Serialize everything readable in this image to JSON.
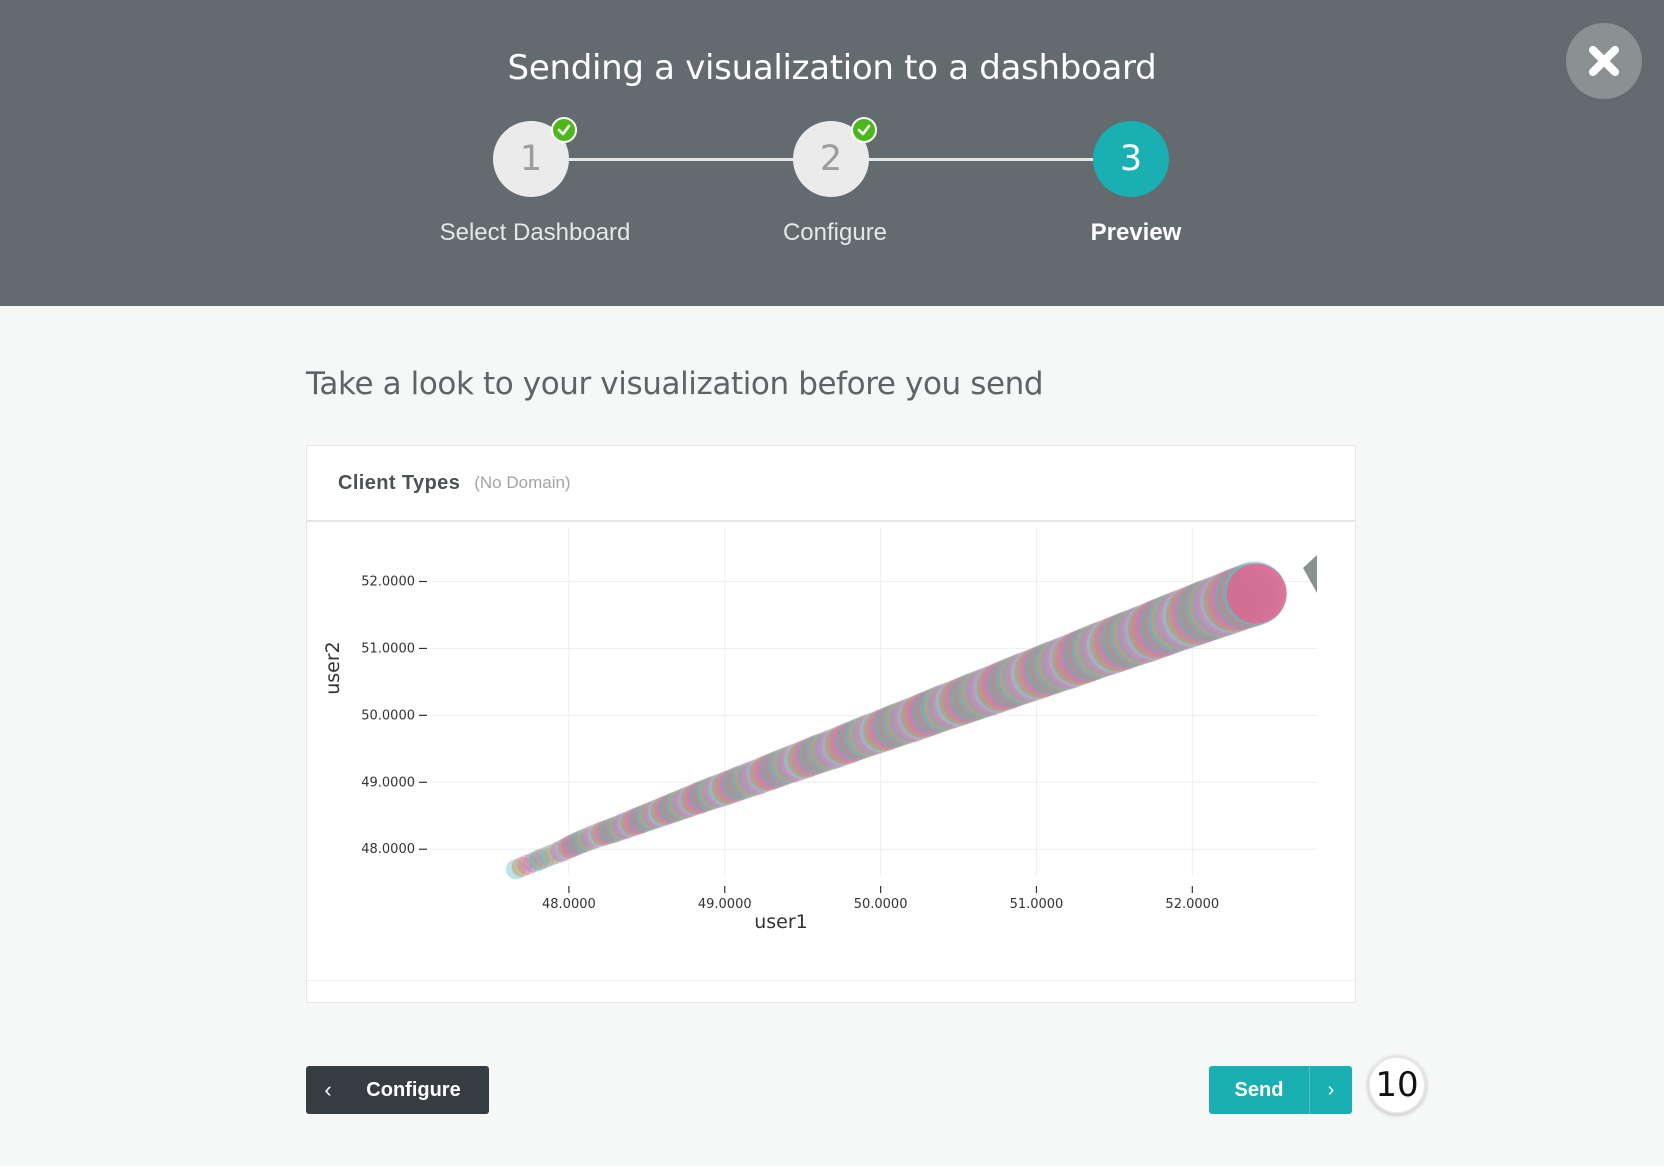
{
  "header": {
    "title": "Sending a visualization to a dashboard",
    "steps": [
      {
        "number": "1",
        "label": "Select Dashboard",
        "completed": true
      },
      {
        "number": "2",
        "label": "Configure",
        "completed": true
      },
      {
        "number": "3",
        "label": "Preview",
        "active": true
      }
    ],
    "close_icon": "close-icon"
  },
  "main": {
    "heading": "Take a look to your visualization before you send"
  },
  "card": {
    "title": "Client Types",
    "subtitle": "(No Domain)"
  },
  "chart_data": {
    "type": "scatter",
    "xlabel": "user1",
    "ylabel": "user2",
    "xlim": [
      47.25,
      52.8
    ],
    "ylim": [
      47.6,
      52.65
    ],
    "x_ticks": [
      "48.0000",
      "49.0000",
      "50.0000",
      "51.0000",
      "52.0000"
    ],
    "x_tick_values": [
      48,
      49,
      50,
      51,
      52
    ],
    "y_ticks": [
      "48.0000",
      "49.0000",
      "50.0000",
      "51.0000",
      "52.0000"
    ],
    "y_tick_values": [
      48,
      49,
      50,
      51,
      52
    ],
    "series": [
      {
        "x": [
          47.66,
          47.81,
          47.95,
          48.02,
          48.1,
          48.2,
          48.28,
          48.36,
          48.44,
          48.52,
          48.6,
          48.68,
          48.76,
          48.84,
          48.92,
          49.0,
          49.1,
          49.2,
          49.3,
          49.4,
          49.5,
          49.6,
          49.7,
          49.8,
          49.9,
          50.0,
          50.1,
          50.2,
          50.3,
          50.4,
          50.5,
          50.6,
          50.7,
          50.8,
          50.9,
          51.0,
          51.1,
          51.2,
          51.3,
          51.4,
          51.5,
          51.6,
          51.7,
          51.8,
          51.9,
          52.0,
          52.1,
          52.2,
          52.3,
          52.4
        ],
        "y": [
          47.7,
          47.84,
          47.97,
          48.05,
          48.13,
          48.22,
          48.28,
          48.35,
          48.42,
          48.49,
          48.56,
          48.63,
          48.7,
          48.77,
          48.84,
          48.9,
          48.99,
          49.07,
          49.16,
          49.25,
          49.33,
          49.42,
          49.5,
          49.59,
          49.68,
          49.76,
          49.85,
          49.93,
          50.02,
          50.11,
          50.19,
          50.28,
          50.36,
          50.45,
          50.54,
          50.62,
          50.71,
          50.79,
          50.88,
          50.97,
          51.05,
          51.14,
          51.22,
          51.31,
          51.4,
          51.48,
          51.57,
          51.65,
          51.74,
          51.82
        ]
      }
    ],
    "point_colors": [
      "#7fcfd8",
      "#c98a4a",
      "#d97a9e",
      "#b27ed9",
      "#5dbb8a",
      "#e07a8b",
      "#59c0c6",
      "#d9a05b",
      "#9f8fe0",
      "#e38aa8"
    ],
    "grid": true
  },
  "footer": {
    "back_label": "Configure",
    "send_label": "Send",
    "step_badge": "10"
  }
}
